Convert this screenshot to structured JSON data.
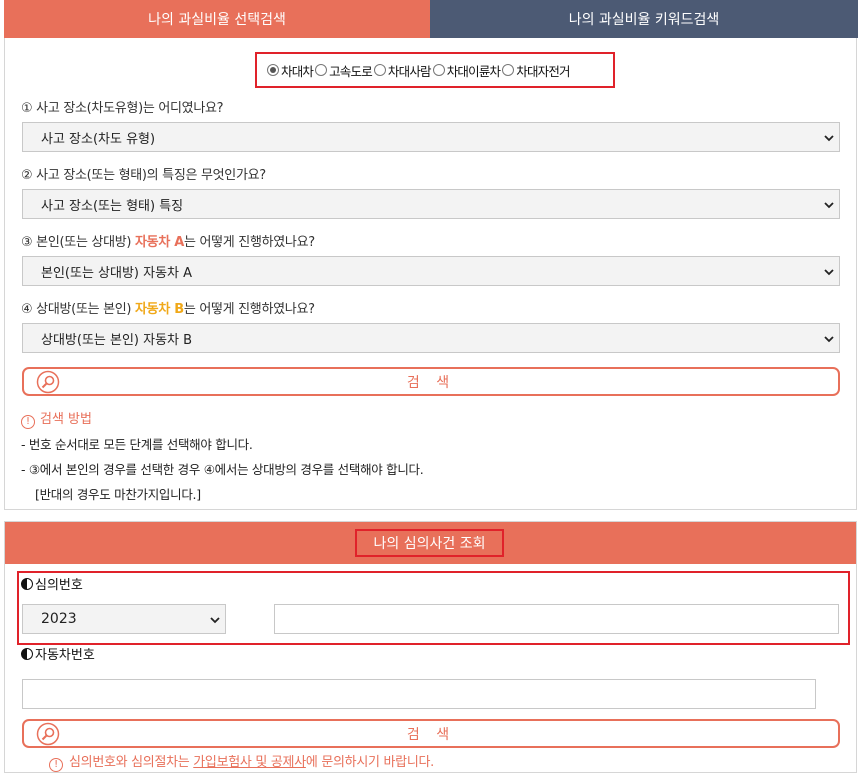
{
  "tabs": {
    "select_search": "나의 과실비율 선택검색",
    "keyword_search": "나의 과실비율 키워드검색"
  },
  "accident_types": {
    "options": [
      "차대차",
      "고속도로",
      "차대사람",
      "차대이륜차",
      "차대자전거"
    ],
    "selected": "차대차"
  },
  "questions": {
    "q1": {
      "text": "① 사고 장소(차도유형)는 어디였나요?",
      "select_value": "사고 장소(차도 유형)"
    },
    "q2": {
      "text": "② 사고 장소(또는 형태)의 특징은 무엇인가요?",
      "select_value": "사고 장소(또는 형태) 특징"
    },
    "q3": {
      "prefix": "③ 본인(또는 상대방) ",
      "highlight": "자동차 A",
      "suffix": "는 어떻게 진행하였나요?",
      "select_value": "본인(또는 상대방) 자동차 A"
    },
    "q4": {
      "prefix": "④ 상대방(또는 본인) ",
      "highlight": "자동차 B",
      "suffix": "는 어떻게 진행하였나요?",
      "select_value": "상대방(또는 본인) 자동차 B"
    }
  },
  "search_button_label": "검 색",
  "guide": {
    "title": "검색 방법",
    "lines": [
      "- 번호 순서대로 모든 단계를 선택해야 합니다.",
      "- ③에서 본인의 경우를 선택한 경우 ④에서는 상대방의 경우를 선택해야 합니다.",
      "[반대의 경우도 마찬가지입니다.]"
    ]
  },
  "case_lookup": {
    "title": "나의 심의사건 조회",
    "case_number_label": "심의번호",
    "year_value": "2023",
    "case_number_value": "",
    "vehicle_number_label": "자동차번호",
    "vehicle_number_value": "",
    "search_label": "검 색",
    "notice_prefix": "심의번호와 심의절차는 ",
    "notice_link": "가입보험사 및 공제사",
    "notice_suffix": "에 문의하시기 바랍니다."
  },
  "colors": {
    "accent": "#e8705a",
    "tab_inactive": "#4c5a74",
    "highlight_b": "#f0a818",
    "red_outline": "#e0222a"
  },
  "icons": [
    "chevron-down-icon",
    "magnifier-icon",
    "info-circle-icon",
    "half-circle-icon"
  ]
}
